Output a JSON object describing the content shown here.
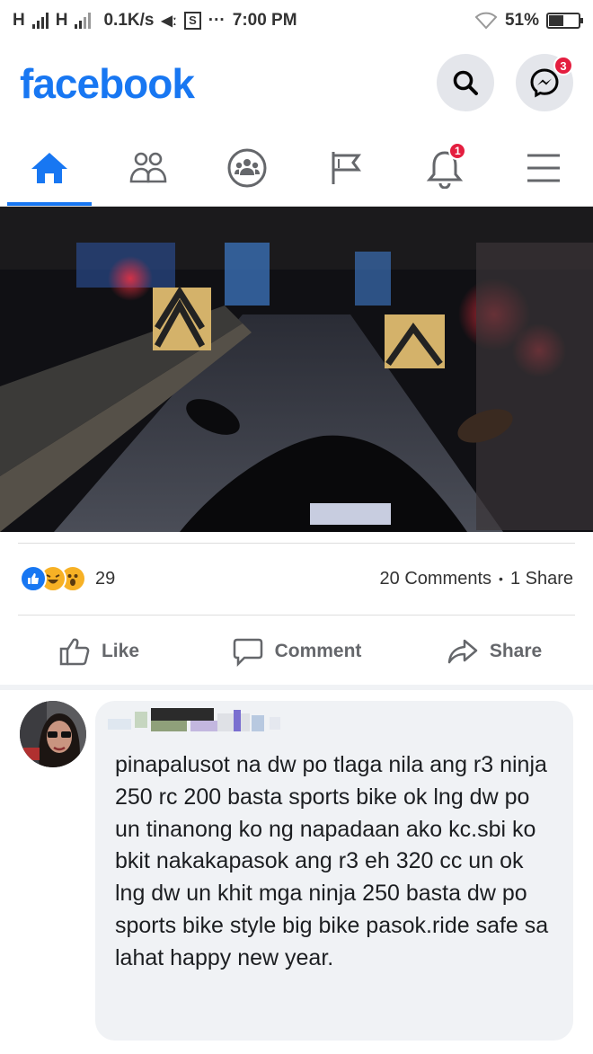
{
  "status_bar": {
    "signal_label_1": "H",
    "signal_label_2": "H",
    "speed": "0.1K/s",
    "extra": "S",
    "dots": "···",
    "time": "7:00 PM",
    "battery": "51%",
    "battery_level": 0.51
  },
  "header": {
    "logo": "facebook",
    "search_icon": "search-icon",
    "messenger_icon": "messenger-icon",
    "messenger_badge": "3",
    "brand_color": "#1877f2"
  },
  "nav": {
    "items": [
      {
        "icon": "home-icon",
        "active": true
      },
      {
        "icon": "friends-icon",
        "active": false
      },
      {
        "icon": "groups-icon",
        "active": false
      },
      {
        "icon": "pages-flag-icon",
        "active": false
      },
      {
        "icon": "notifications-bell-icon",
        "active": false,
        "badge": "1"
      },
      {
        "icon": "menu-icon",
        "active": false
      }
    ],
    "notification_badge": "1"
  },
  "post": {
    "photo_icon": "toll-gate-motorcycle-photo",
    "reactions": [
      "like",
      "haha",
      "wow"
    ],
    "reaction_count": "29",
    "comments": "20 Comments",
    "separator": "•",
    "shares": "1 Share",
    "actions": {
      "like": "Like",
      "comment": "Comment",
      "share": "Share"
    }
  },
  "comment": {
    "text": "pinapalusot na dw po tlaga nila ang r3 ninja 250 rc 200 basta sports bike ok lng dw po un tinanong ko ng napadaan ako kc.sbi ko bkit nakakapasok ang r3 eh 320 cc un ok lng dw un khit mga ninja 250 basta dw po sports bike style big bike pasok.ride safe sa lahat happy new year."
  }
}
